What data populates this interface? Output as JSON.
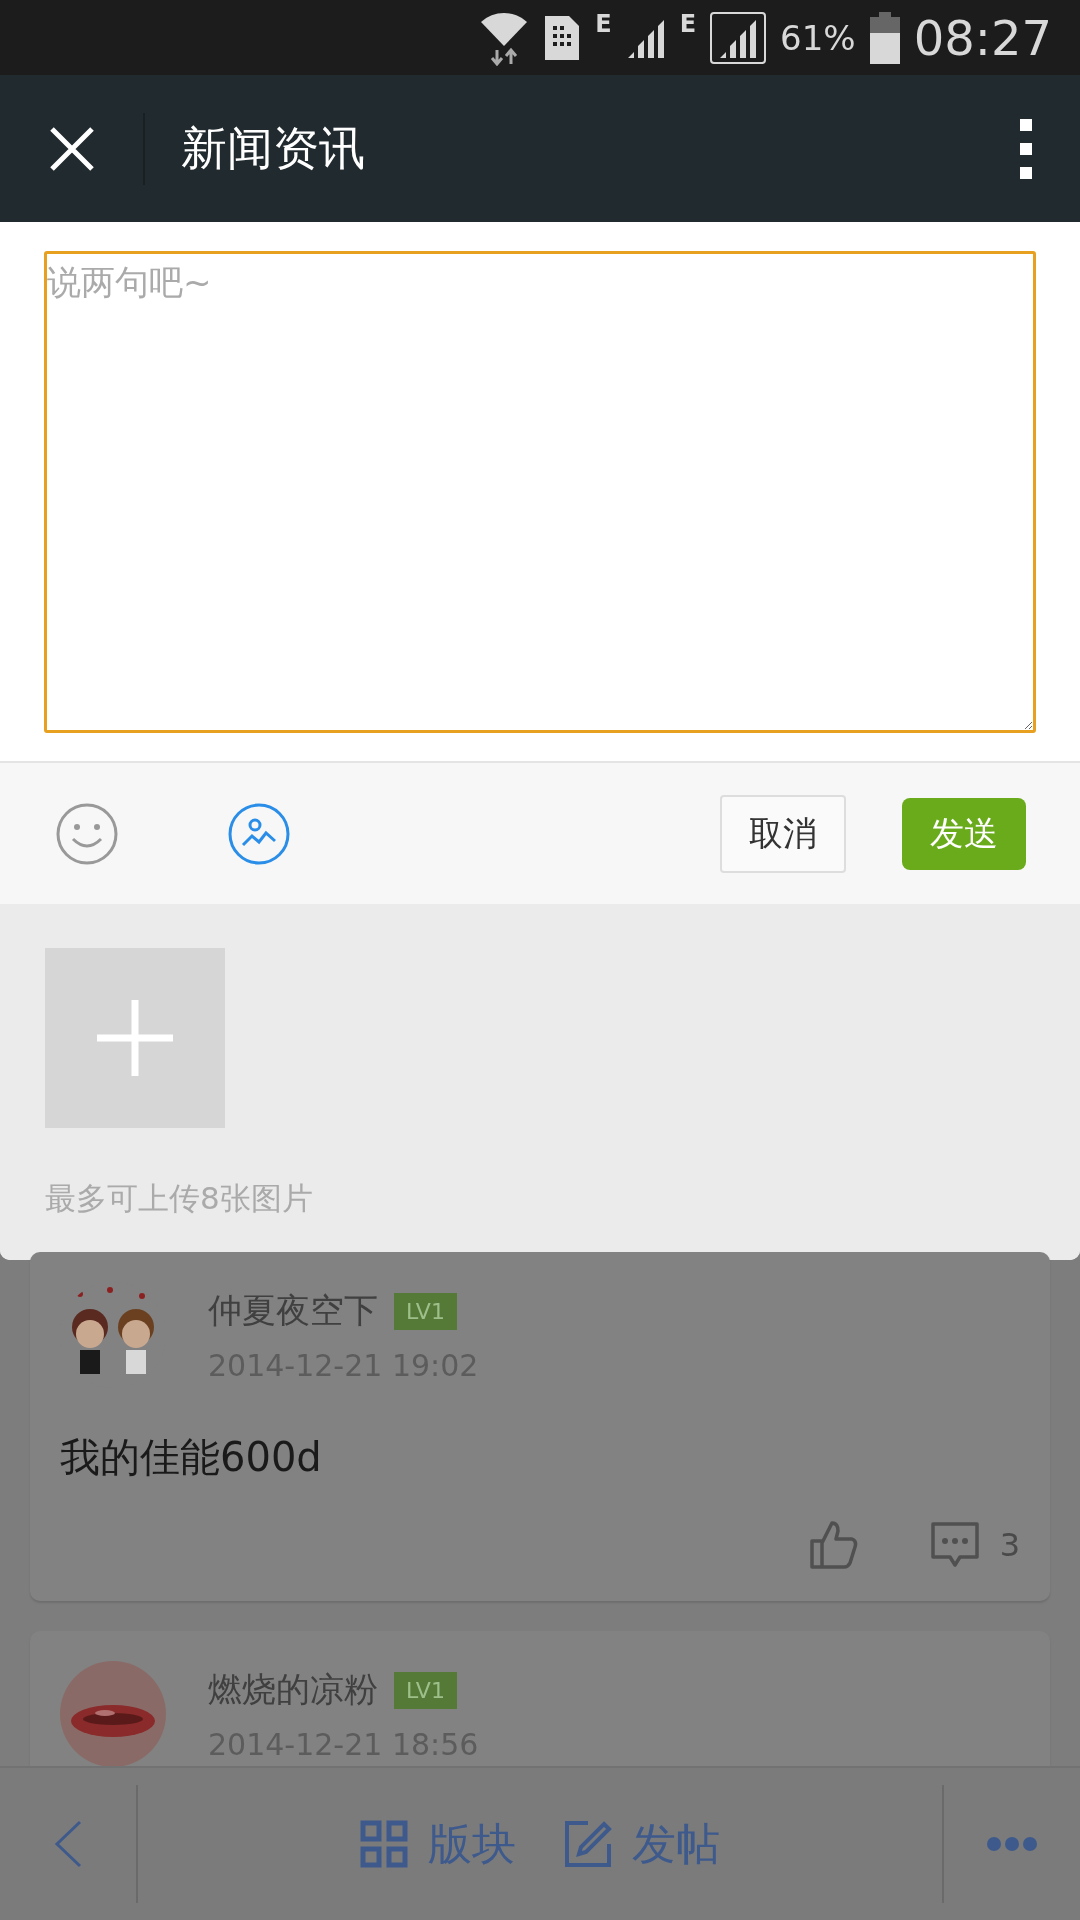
{
  "status_bar": {
    "network_labels": [
      "E",
      "E"
    ],
    "battery_percent": "61%",
    "time": "08:27"
  },
  "title_bar": {
    "title": "新闻资讯"
  },
  "composer": {
    "placeholder": "说两句吧~",
    "cancel": "取消",
    "send": "发送",
    "upload_hint": "最多可上传8张图片"
  },
  "posts": [
    {
      "author": "仲夏夜空下",
      "level_badge": "LV1",
      "time": "2014-12-21 19:02",
      "text": "我的佳能600d",
      "comment_count": "3"
    },
    {
      "author": "燃烧的凉粉",
      "level_badge": "LV1",
      "time": "2014-12-21 18:56"
    }
  ],
  "bottom_bar": {
    "items": [
      {
        "label": "版块",
        "kind": "grid"
      },
      {
        "label": "发帖",
        "kind": "compose"
      }
    ]
  }
}
